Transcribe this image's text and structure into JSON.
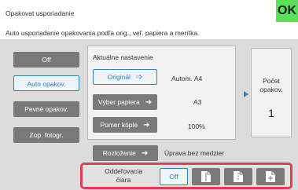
{
  "header": {
    "title": "Opakovat usporiadanie",
    "subtitle": "Auto usporiadanie opakovania podľa orig., veľ. papiera a merítka.",
    "ok_label": "OK"
  },
  "modes": [
    {
      "label": "Off",
      "selected": false
    },
    {
      "label": "Auto opakov.",
      "selected": true
    },
    {
      "label": "Pevné opakov.",
      "selected": false
    },
    {
      "label": "Zop. fotogr.",
      "selected": false
    }
  ],
  "current_settings": {
    "title": "Aktuálne nastavenie",
    "original_label": "Originál",
    "original_value": "Autom. A4",
    "paper_label": "Výber papiera",
    "paper_value": "A3",
    "ratio_label": "Pomer kópie",
    "ratio_value": "100%"
  },
  "copies": {
    "label_line1": "Počet",
    "label_line2": "opakov.",
    "value": "1"
  },
  "layout": {
    "label": "Rozloženie",
    "value": "Úprava bez medzier"
  },
  "separator": {
    "label_line1": "Oddeľovacia",
    "label_line2": "čiara",
    "off_label": "Off",
    "options": [
      "line-none-icon",
      "line-dashed-icon",
      "line-cross-icon"
    ]
  },
  "colors": {
    "accent": "#3384b6",
    "ok_green": "#5be05b",
    "highlight_red": "#e04050"
  }
}
